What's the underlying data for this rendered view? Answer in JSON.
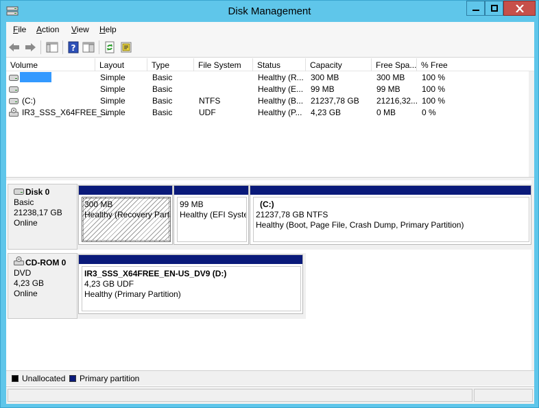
{
  "window": {
    "title": "Disk Management"
  },
  "menu": [
    {
      "label": "File",
      "key": "F",
      "rest": "ile"
    },
    {
      "label": "Action",
      "key": "A",
      "rest": "ction"
    },
    {
      "label": "View",
      "key": "V",
      "rest": "iew"
    },
    {
      "label": "Help",
      "key": "H",
      "rest": "elp"
    }
  ],
  "toolbar": {
    "icons": [
      "back-arrow-icon",
      "forward-arrow-icon",
      "console-tree-icon",
      "help-icon",
      "show-pane-icon",
      "refresh-icon",
      "properties-icon"
    ]
  },
  "volume_list": {
    "columns": [
      "Volume",
      "Layout",
      "Type",
      "File System",
      "Status",
      "Capacity",
      "Free Spa...",
      "% Free"
    ],
    "rows": [
      {
        "volume": "",
        "layout": "Simple",
        "type": "Basic",
        "fs": "",
        "status": "Healthy (R...",
        "capacity": "300 MB",
        "free": "300 MB",
        "pct": "100 %",
        "icon": "disk-volume-icon"
      },
      {
        "volume": "",
        "layout": "Simple",
        "type": "Basic",
        "fs": "",
        "status": "Healthy (E...",
        "capacity": "99 MB",
        "free": "99 MB",
        "pct": "100 %",
        "icon": "disk-volume-icon"
      },
      {
        "volume": "(C:)",
        "layout": "Simple",
        "type": "Basic",
        "fs": "NTFS",
        "status": "Healthy (B...",
        "capacity": "21237,78 GB",
        "free": "21216,32...",
        "pct": "100 %",
        "icon": "disk-volume-icon"
      },
      {
        "volume": "IR3_SSS_X64FREE_...",
        "layout": "Simple",
        "type": "Basic",
        "fs": "UDF",
        "status": "Healthy (P...",
        "capacity": "4,23 GB",
        "free": "0 MB",
        "pct": "0 %",
        "icon": "cdrom-volume-icon"
      }
    ]
  },
  "disks": [
    {
      "name": "Disk 0",
      "kind": "Basic",
      "size": "21238,17 GB",
      "state": "Online",
      "partitions": [
        {
          "title": "",
          "line1": "300 MB",
          "line2": "Healthy (Recovery Partition)"
        },
        {
          "title": "",
          "line1": "99 MB",
          "line2": "Healthy (EFI System Partition)"
        },
        {
          "title": "(C:)",
          "line1": "21237,78 GB NTFS",
          "line2": "Healthy (Boot, Page File, Crash Dump, Primary Partition)"
        }
      ]
    },
    {
      "name": "CD-ROM 0",
      "kind": "DVD",
      "size": "4,23 GB",
      "state": "Online",
      "partitions": [
        {
          "title": "IR3_SSS_X64FREE_EN-US_DV9  (D:)",
          "line1": "4,23 GB UDF",
          "line2": "Healthy (Primary Partition)"
        }
      ]
    }
  ],
  "legend": [
    {
      "label": "Unallocated",
      "color": "#000000"
    },
    {
      "label": "Primary partition",
      "color": "#0a1a7a"
    }
  ]
}
